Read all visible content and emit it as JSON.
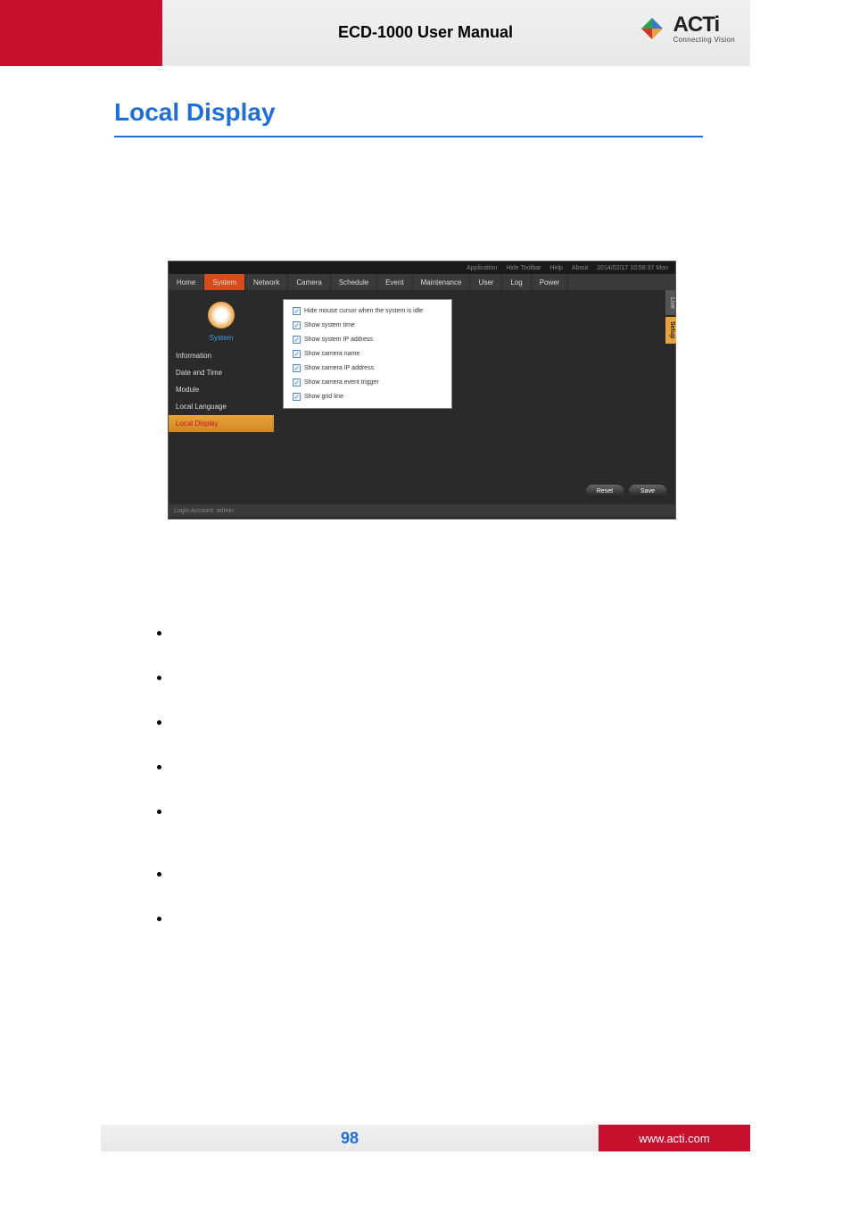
{
  "header": {
    "title": "ECD-1000 User Manual",
    "logo_main": "ACTi",
    "logo_sub": "Connecting Vision"
  },
  "section_title": "Local Display",
  "shot": {
    "topbar": [
      "Application",
      "Hide Toolbar",
      "Help",
      "About",
      "2014/02/17 10:58:37 Mon"
    ],
    "tabs": [
      "Home",
      "System",
      "Network",
      "Camera",
      "Schedule",
      "Event",
      "Maintenance",
      "User",
      "Log",
      "Power"
    ],
    "active_tab": "System",
    "sidebar": {
      "label": "System",
      "items": [
        "Information",
        "Date and Time",
        "Module",
        "Local Language",
        "Local Display"
      ],
      "active": "Local Display"
    },
    "checkboxes": [
      "Hide mouse cursor when the system is idle",
      "Show system time",
      "Show system IP address",
      "Show camera name",
      "Show camera IP address",
      "Show camera event trigger",
      "Show grid line"
    ],
    "side_tabs": {
      "live": "Live",
      "setup": "Setup"
    },
    "buttons": {
      "reset": "Reset",
      "save": "Save"
    },
    "footer": "Login Account: admin"
  },
  "footer": {
    "page": "98",
    "url": "www.acti.com"
  }
}
